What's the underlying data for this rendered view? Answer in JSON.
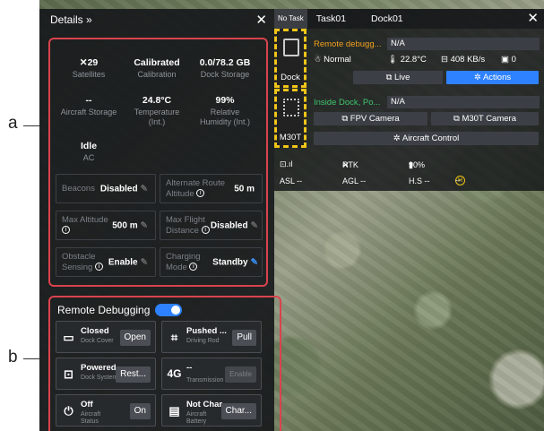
{
  "labels": {
    "a": "a",
    "b": "b"
  },
  "details": {
    "title": "Details »",
    "stats": [
      {
        "value": "29",
        "label": "Satellites",
        "icon": "satellite-icon"
      },
      {
        "value": "Calibrated",
        "label": "Calibration"
      },
      {
        "value": "0.0/78.2 GB",
        "label": "Dock Storage"
      },
      {
        "value": "--",
        "label": "Aircraft Storage"
      },
      {
        "value": "24.8°C",
        "label": "Temperature (Int.)"
      },
      {
        "value": "99%",
        "label": "Relative Humidity (Int.)"
      },
      {
        "value": "Idle",
        "label": "AC"
      }
    ],
    "controls": [
      {
        "label": "Beacons",
        "value": "Disabled"
      },
      {
        "label": "Alternate Route Altitude",
        "value": "50 m"
      },
      {
        "label": "Max Altitude",
        "value": "500 m"
      },
      {
        "label": "Max Flight Distance",
        "value": "Disabled"
      },
      {
        "label": "Obstacle Sensing",
        "value": "Enable"
      },
      {
        "label": "Charging Mode",
        "value": "Standby"
      }
    ]
  },
  "debug": {
    "title": "Remote Debugging",
    "cards": [
      {
        "status": "Closed",
        "name": "Dock Cover",
        "button": "Open",
        "icon": "dock-cover-icon"
      },
      {
        "status": "Pushed ...",
        "name": "Driving Rod",
        "button": "Pull",
        "icon": "driving-rod-icon"
      },
      {
        "status": "Powered...",
        "name": "Dock System",
        "button": "Rest...",
        "icon": "dock-system-icon"
      },
      {
        "status": "--",
        "name": "Transmission",
        "button": "Enable",
        "icon": "4g-icon",
        "icon_text": "4G"
      },
      {
        "status": "Off",
        "name": "Aircraft Status",
        "button": "On",
        "icon": "power-icon"
      },
      {
        "status": "Not Char...",
        "name": "Aircraft Battery",
        "button": "Char...",
        "icon": "battery-icon"
      }
    ]
  },
  "topbar": {
    "no_task": "No Task",
    "task": "Task01",
    "dock": "Dock01"
  },
  "dock_device": {
    "label": "Dock",
    "title": "Remote debugg...",
    "title_color": "#f0a020",
    "na": "N/A",
    "mode": "Normal",
    "temp": "22.8°C",
    "rate": "408 KB/s",
    "count": "0",
    "live": "Live",
    "actions": "Actions"
  },
  "drone_device": {
    "label": "M30T",
    "title": "Inside Dock, Po...",
    "title_color": "#3ec46d",
    "na": "N/A",
    "fpv": "FPV Camera",
    "m30t": "M30T Camera",
    "aircraft_control": "Aircraft Control"
  },
  "telemetry": {
    "rtk": "RTK",
    "rtk_val": "--",
    "battery": "90%",
    "asl": "ASL --",
    "agl": "AGL --",
    "hs": "H.S --",
    "h_val": "--"
  },
  "colors": {
    "accent": "#2f82ff",
    "highlight": "#d9434d",
    "hazard": "#f0c419"
  }
}
